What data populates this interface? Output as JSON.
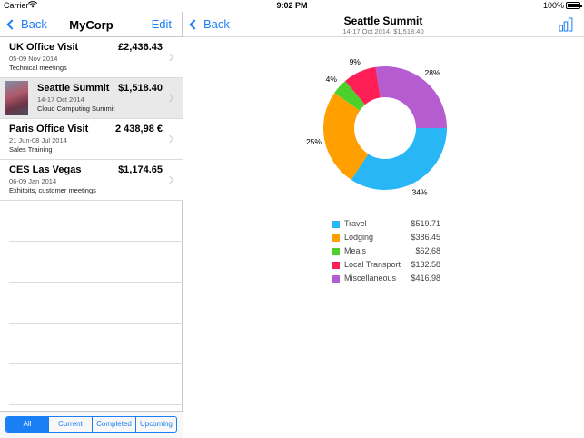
{
  "status_bar": {
    "carrier": "Carrier",
    "time": "9:02 PM",
    "battery": "100%"
  },
  "master": {
    "back_label": "Back",
    "title": "MyCorp",
    "edit_label": "Edit",
    "trips": [
      {
        "title": "UK Office Visit",
        "amount": "£2,436.43",
        "date": "05-09 Nov 2014",
        "desc": "Technical meetings"
      },
      {
        "title": "Seattle Summit",
        "amount": "$1,518.40",
        "date": "14-17 Oct 2014",
        "desc": "Cloud Computing Summit"
      },
      {
        "title": "Paris Office Visit",
        "amount": "2 438,98 €",
        "date": "21 Jun-08 Jul 2014",
        "desc": "Sales Training"
      },
      {
        "title": "CES Las Vegas",
        "amount": "$1,174.65",
        "date": "06-09 Jan 2014",
        "desc": "Exhitbits, customer meetings"
      }
    ],
    "segments": [
      "All",
      "Current",
      "Completed",
      "Upcoming"
    ],
    "active_segment": "All"
  },
  "detail": {
    "back_label": "Back",
    "title": "Seattle Summit",
    "subtitle": "14-17 Oct 2014, $1,518.40",
    "chart_icon": "bar-chart-icon"
  },
  "chart_data": {
    "type": "pie",
    "style": "donut",
    "categories": [
      "Travel",
      "Lodging",
      "Meals",
      "Local Transport",
      "Miscellaneous"
    ],
    "values": [
      519.71,
      386.45,
      62.68,
      132.58,
      416.98
    ],
    "value_labels": [
      "$519.71",
      "$386.45",
      "$62.68",
      "$132.58",
      "$416.98"
    ],
    "percent_labels": [
      "34%",
      "25%",
      "4%",
      "9%",
      "28%"
    ],
    "colors": [
      "#29b6f6",
      "#ffa000",
      "#4cd12c",
      "#ff1f56",
      "#b45cd0"
    ],
    "legend_position": "bottom"
  }
}
